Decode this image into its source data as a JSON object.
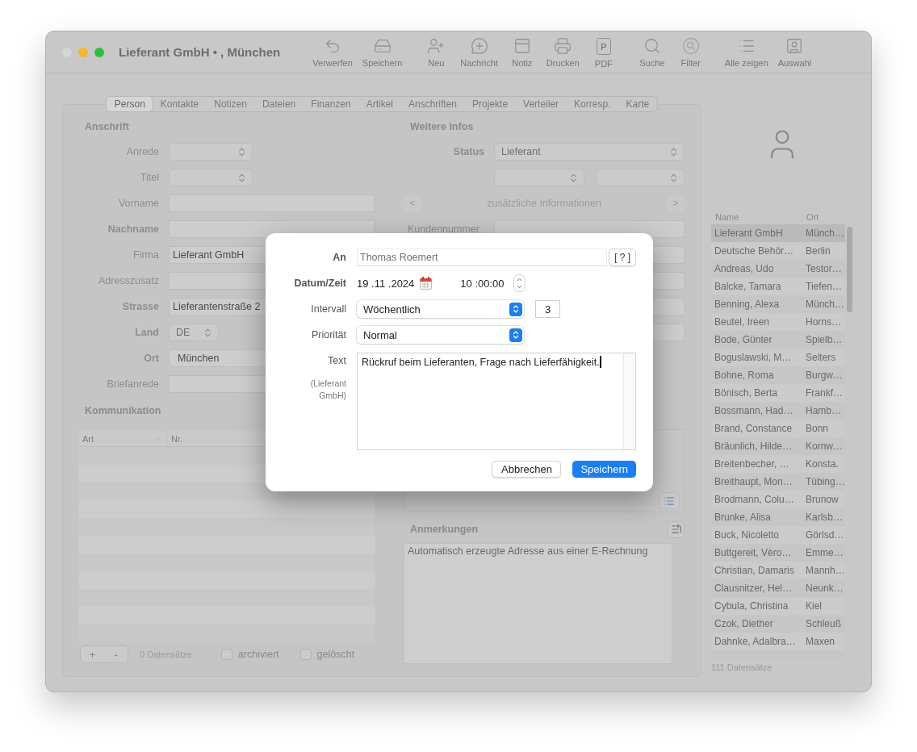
{
  "window": {
    "title": "Lieferant GmbH • , München"
  },
  "toolbar": [
    {
      "items": [
        {
          "kind": "undo",
          "label": "Verwerfen"
        },
        {
          "kind": "drive",
          "label": "Speichern"
        }
      ]
    },
    {
      "items": [
        {
          "kind": "add-person",
          "label": "Neu"
        },
        {
          "kind": "message",
          "label": "Nachricht"
        },
        {
          "kind": "note",
          "label": "Notiz"
        },
        {
          "kind": "print",
          "label": "Drucken"
        },
        {
          "kind": "pdf",
          "label": "PDF",
          "glyph": "P"
        }
      ]
    },
    {
      "items": [
        {
          "kind": "search",
          "label": "Suche"
        },
        {
          "kind": "filter",
          "label": "Filter"
        }
      ]
    },
    {
      "items": [
        {
          "kind": "list",
          "label": "Alle zeigen"
        },
        {
          "kind": "frame",
          "label": "Auswahl"
        }
      ]
    }
  ],
  "tabs": [
    {
      "label": "Person",
      "selected": true
    },
    {
      "label": "Kontakte",
      "selected": false
    },
    {
      "label": "Notizen",
      "selected": false
    },
    {
      "label": "Dateien",
      "selected": false
    },
    {
      "label": "Finanzen",
      "selected": false
    },
    {
      "label": "Artikel",
      "selected": false
    },
    {
      "label": "Anschriften",
      "selected": false
    },
    {
      "label": "Projekte",
      "selected": false
    },
    {
      "label": "Verteiler",
      "selected": false
    },
    {
      "label": "Korresp.",
      "selected": false
    },
    {
      "label": "Karte",
      "selected": false
    }
  ],
  "address": {
    "heading": "Anschrift",
    "rows": [
      {
        "kind": "select",
        "label": "Anrede",
        "bold": false
      },
      {
        "kind": "select",
        "label": "Titel",
        "bold": false
      },
      {
        "kind": "field",
        "label": "Vorname",
        "bold": false
      },
      {
        "kind": "field",
        "label": "Nachname",
        "bold": true
      },
      {
        "kind": "field",
        "label": "Firma",
        "bold": false,
        "value": "Lieferant GmbH"
      },
      {
        "kind": "field",
        "label": "Adresszusatz",
        "bold": false
      },
      {
        "kind": "field",
        "label": "Strasse",
        "bold": true,
        "value": "Lieferantenstraße 2"
      },
      {
        "kind": "country",
        "label": "Land",
        "bold": true,
        "value": "DE"
      },
      {
        "kind": "combo",
        "label": "Ort",
        "bold": true,
        "value": "München"
      },
      {
        "kind": "field",
        "label": "Briefanrede",
        "bold": false
      }
    ]
  },
  "communication": {
    "heading": "Kommunikation",
    "columns": [
      {
        "label": "Art",
        "sorted": true
      },
      {
        "label": "Nr.",
        "sorted": false
      }
    ],
    "add": "+",
    "remove": "-",
    "count": "0 Datensätze",
    "checkboxes": [
      {
        "label": "archiviert",
        "checked": false
      },
      {
        "label": "gelöscht",
        "checked": false
      }
    ]
  },
  "more_info": {
    "heading": "Weitere Infos",
    "status": {
      "label": "Status",
      "value": "Lieferant"
    },
    "nav": {
      "prev": "<",
      "title": "zusätzliche Informationen",
      "next": ">"
    },
    "customer_number": {
      "label": "Kundennummer"
    }
  },
  "notes": {
    "heading": "Anmerkungen",
    "text": "Automatisch erzeugte Adresse aus einer E-Rechnung"
  },
  "contacts": {
    "columns": [
      "Name",
      "Ort"
    ],
    "rows": [
      {
        "name": "Lieferant GmbH",
        "city": "Münch…",
        "selected": true
      },
      {
        "name": "Deutsche Behör…",
        "city": "Berlin",
        "selected": false
      },
      {
        "name": "Andreas, Udo",
        "city": "Testor…",
        "selected": false
      },
      {
        "name": "Balcke, Tamara",
        "city": "Tiefen…",
        "selected": false
      },
      {
        "name": "Benning, Alexa",
        "city": "Münch…",
        "selected": false
      },
      {
        "name": "Beutel, Ireen",
        "city": "Horns…",
        "selected": false
      },
      {
        "name": "Bode, Günter",
        "city": "Spielb…",
        "selected": false
      },
      {
        "name": "Boguslawski, M…",
        "city": "Selters",
        "selected": false
      },
      {
        "name": "Bohne, Roma",
        "city": "Burgw…",
        "selected": false
      },
      {
        "name": "Bönisch, Berta",
        "city": "Frankf…",
        "selected": false
      },
      {
        "name": "Bossmann, Had…",
        "city": "Hamb…",
        "selected": false
      },
      {
        "name": "Brand, Constance",
        "city": "Bonn",
        "selected": false
      },
      {
        "name": "Bräunlich, Hilde…",
        "city": "Kornw…",
        "selected": false
      },
      {
        "name": "Breitenbecher, …",
        "city": "Konsta.",
        "selected": false
      },
      {
        "name": "Breithaupt, Mon…",
        "city": "Tübing…",
        "selected": false
      },
      {
        "name": "Brodmann, Colu…",
        "city": "Brunow",
        "selected": false
      },
      {
        "name": "Brunke, Alisa",
        "city": "Karlsb…",
        "selected": false
      },
      {
        "name": "Buck, Nicoletto",
        "city": "Görlsd…",
        "selected": false
      },
      {
        "name": "Buttgereit, Vèro…",
        "city": "Emme…",
        "selected": false
      },
      {
        "name": "Christian, Damaris",
        "city": "Mannh…",
        "selected": false
      },
      {
        "name": "Clausnitzer, Hel…",
        "city": "Neunk…",
        "selected": false
      },
      {
        "name": "Cybula, Christina",
        "city": "Kiel",
        "selected": false
      },
      {
        "name": "Czok, Diether",
        "city": "Schleuß",
        "selected": false
      },
      {
        "name": "Dahnke, Adalbra…",
        "city": "Maxen",
        "selected": false
      }
    ],
    "count": "111 Datensätze"
  },
  "dialog": {
    "to": {
      "label": "An",
      "value": "Thomas Roemert",
      "help": "[ ? ]"
    },
    "datetime": {
      "label": "Datum/Zeit",
      "date": "19 .11 .2024",
      "time": "10 :00:00"
    },
    "interval": {
      "label": "Intervall",
      "value": "Wöchentlich",
      "count": "3"
    },
    "priority": {
      "label": "Priorität",
      "value": "Normal"
    },
    "text": {
      "label": "Text",
      "context": "(Lieferant GmbH)",
      "value": "Rückruf beim Lieferanten, Frage nach Lieferfähigkeit.",
      "focused": true
    },
    "buttons": [
      {
        "label": "Abbrechen",
        "default": false
      },
      {
        "label": "Speichern",
        "default": true
      }
    ]
  }
}
